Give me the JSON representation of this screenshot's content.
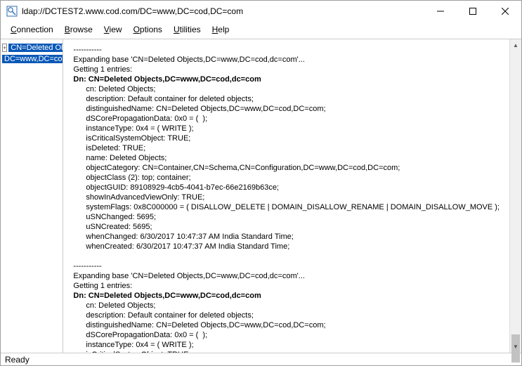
{
  "window": {
    "title": "ldap://DCTEST2.www.cod.com/DC=www,DC=cod,DC=com"
  },
  "menu": {
    "items": [
      {
        "u": "C",
        "rest": "onnection"
      },
      {
        "u": "B",
        "rest": "rowse"
      },
      {
        "u": "V",
        "rest": "iew"
      },
      {
        "u": "O",
        "rest": "ptions"
      },
      {
        "u": "U",
        "rest": "tilities"
      },
      {
        "u": "H",
        "rest": "elp"
      }
    ]
  },
  "tree": {
    "node0": "CN=Deleted Objects,",
    "node1": "DC=www,DC=cod,dc=com"
  },
  "detail": {
    "block1": {
      "dashes": "-----------",
      "expand": "Expanding base 'CN=Deleted Objects,DC=www,DC=cod,dc=com'...",
      "getting": "Getting 1 entries:",
      "dn": "Dn: CN=Deleted Objects,DC=www,DC=cod,dc=com",
      "attrs": [
        "cn: Deleted Objects;",
        "description: Default container for deleted objects;",
        "distinguishedName: CN=Deleted Objects,DC=www,DC=cod,DC=com;",
        "dSCorePropagationData: 0x0 = (  );",
        "instanceType: 0x4 = ( WRITE );",
        "isCriticalSystemObject: TRUE;",
        "isDeleted: TRUE;",
        "name: Deleted Objects;",
        "objectCategory: CN=Container,CN=Schema,CN=Configuration,DC=www,DC=cod,DC=com;",
        "objectClass (2): top; container;",
        "objectGUID: 89108929-4cb5-4041-b7ec-66e2169b63ce;",
        "showInAdvancedViewOnly: TRUE;",
        "systemFlags: 0x8C000000 = ( DISALLOW_DELETE | DOMAIN_DISALLOW_RENAME | DOMAIN_DISALLOW_MOVE );",
        "uSNChanged: 5695;",
        "uSNCreated: 5695;",
        "whenChanged: 6/30/2017 10:47:37 AM India Standard Time;",
        "whenCreated: 6/30/2017 10:47:37 AM India Standard Time;"
      ]
    },
    "block2": {
      "dashes": "-----------",
      "expand": "Expanding base 'CN=Deleted Objects,DC=www,DC=cod,dc=com'...",
      "getting": "Getting 1 entries:",
      "dn": "Dn: CN=Deleted Objects,DC=www,DC=cod,dc=com",
      "attrs": [
        "cn: Deleted Objects;",
        "description: Default container for deleted objects;",
        "distinguishedName: CN=Deleted Objects,DC=www,DC=cod,DC=com;",
        "dSCorePropagationData: 0x0 = (  );",
        "instanceType: 0x4 = ( WRITE );",
        "isCriticalSystemObject: TRUE;"
      ]
    }
  },
  "status": {
    "text": "Ready"
  }
}
